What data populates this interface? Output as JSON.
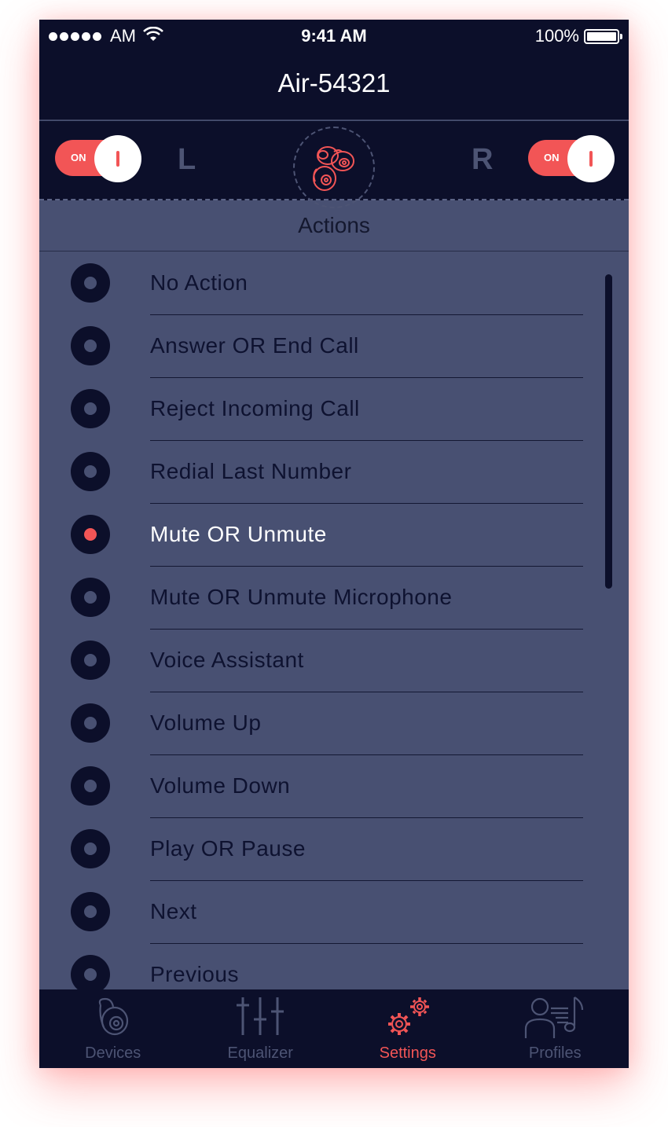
{
  "status_bar": {
    "carrier": "AM",
    "time": "9:41 AM",
    "battery": "100%"
  },
  "nav": {
    "title": "Air-54321"
  },
  "device": {
    "left_toggle": "ON",
    "right_toggle": "ON",
    "left_letter": "L",
    "right_letter": "R"
  },
  "actions": {
    "title": "Actions",
    "selected_index": 4,
    "items": [
      {
        "label": "No Action"
      },
      {
        "label": "Answer OR End Call"
      },
      {
        "label": "Reject Incoming Call"
      },
      {
        "label": "Redial Last Number"
      },
      {
        "label": "Mute OR Unmute"
      },
      {
        "label": "Mute OR Unmute Microphone"
      },
      {
        "label": "Voice Assistant"
      },
      {
        "label": "Volume Up"
      },
      {
        "label": "Volume Down"
      },
      {
        "label": "Play OR Pause"
      },
      {
        "label": "Next"
      },
      {
        "label": "Previous"
      }
    ]
  },
  "tabbar": {
    "items": [
      {
        "label": "Devices",
        "icon": "earbud-icon"
      },
      {
        "label": "Equalizer",
        "icon": "equalizer-icon"
      },
      {
        "label": "Settings",
        "icon": "gears-icon"
      },
      {
        "label": "Profiles",
        "icon": "profile-music-icon"
      }
    ],
    "active_index": 2
  },
  "colors": {
    "accent": "#f25556",
    "dark": "#0c0f2a",
    "panel": "#485072",
    "muted": "#4d5474"
  }
}
